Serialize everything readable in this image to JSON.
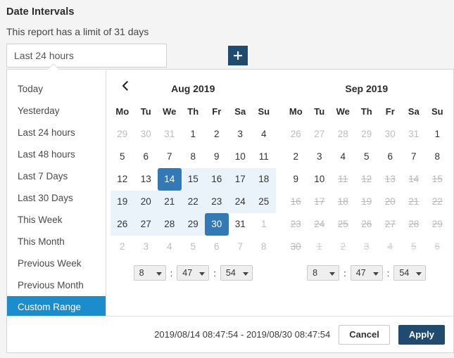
{
  "header": {
    "title": "Date Intervals",
    "limit_note": "This report has a limit of 31 days"
  },
  "input": {
    "value": "Last 24 hours",
    "placeholder": "Last 24 hours"
  },
  "add_button": {
    "icon": "plus-icon",
    "label": "+"
  },
  "colors": {
    "accent_navy": "#214b6e",
    "active_blue": "#1b8dcd",
    "selected_day": "#3279b5",
    "range_highlight": "#eaf3f9"
  },
  "ranges": {
    "items": [
      {
        "label": "Today",
        "active": false
      },
      {
        "label": "Yesterday",
        "active": false
      },
      {
        "label": "Last 24 hours",
        "active": false
      },
      {
        "label": "Last 48 hours",
        "active": false
      },
      {
        "label": "Last 7 Days",
        "active": false
      },
      {
        "label": "Last 30 Days",
        "active": false
      },
      {
        "label": "This Week",
        "active": false
      },
      {
        "label": "This Month",
        "active": false
      },
      {
        "label": "Previous Week",
        "active": false
      },
      {
        "label": "Previous Month",
        "active": false
      },
      {
        "label": "Custom Range",
        "active": true
      }
    ]
  },
  "calendar_left": {
    "title": "Aug 2019",
    "prev_icon": "chevron-left-icon",
    "weekdays": [
      "Mo",
      "Tu",
      "We",
      "Th",
      "Fr",
      "Sa",
      "Su"
    ],
    "weeks": [
      [
        {
          "d": "29",
          "off": true
        },
        {
          "d": "30",
          "off": true
        },
        {
          "d": "31",
          "off": true
        },
        {
          "d": "1"
        },
        {
          "d": "2"
        },
        {
          "d": "3"
        },
        {
          "d": "4"
        }
      ],
      [
        {
          "d": "5"
        },
        {
          "d": "6"
        },
        {
          "d": "7"
        },
        {
          "d": "8"
        },
        {
          "d": "9"
        },
        {
          "d": "10"
        },
        {
          "d": "11"
        }
      ],
      [
        {
          "d": "12"
        },
        {
          "d": "13"
        },
        {
          "d": "14",
          "sel": true,
          "range": true
        },
        {
          "d": "15",
          "range": true
        },
        {
          "d": "16",
          "range": true
        },
        {
          "d": "17",
          "range": true
        },
        {
          "d": "18",
          "range": true
        }
      ],
      [
        {
          "d": "19",
          "range": true
        },
        {
          "d": "20",
          "range": true
        },
        {
          "d": "21",
          "range": true
        },
        {
          "d": "22",
          "range": true
        },
        {
          "d": "23",
          "range": true
        },
        {
          "d": "24",
          "range": true
        },
        {
          "d": "25",
          "range": true
        }
      ],
      [
        {
          "d": "26",
          "range": true
        },
        {
          "d": "27",
          "range": true
        },
        {
          "d": "28",
          "range": true
        },
        {
          "d": "29",
          "range": true
        },
        {
          "d": "30",
          "sel": true,
          "range": true
        },
        {
          "d": "31"
        },
        {
          "d": "1",
          "off": true
        }
      ],
      [
        {
          "d": "2",
          "off": true
        },
        {
          "d": "3",
          "off": true
        },
        {
          "d": "4",
          "off": true
        },
        {
          "d": "5",
          "off": true
        },
        {
          "d": "6",
          "off": true
        },
        {
          "d": "7",
          "off": true
        },
        {
          "d": "8",
          "off": true
        }
      ]
    ],
    "time": {
      "hour": "8",
      "minute": "47",
      "second": "54"
    }
  },
  "calendar_right": {
    "title": "Sep 2019",
    "weekdays": [
      "Mo",
      "Tu",
      "We",
      "Th",
      "Fr",
      "Sa",
      "Su"
    ],
    "weeks": [
      [
        {
          "d": "26",
          "off": true
        },
        {
          "d": "27",
          "off": true
        },
        {
          "d": "28",
          "off": true
        },
        {
          "d": "29",
          "off": true
        },
        {
          "d": "30",
          "off": true
        },
        {
          "d": "31",
          "off": true
        },
        {
          "d": "1"
        }
      ],
      [
        {
          "d": "2"
        },
        {
          "d": "3"
        },
        {
          "d": "4"
        },
        {
          "d": "5"
        },
        {
          "d": "6"
        },
        {
          "d": "7"
        },
        {
          "d": "8"
        }
      ],
      [
        {
          "d": "9"
        },
        {
          "d": "10"
        },
        {
          "d": "11",
          "disabled": true
        },
        {
          "d": "12",
          "disabled": true
        },
        {
          "d": "13",
          "disabled": true
        },
        {
          "d": "14",
          "disabled": true
        },
        {
          "d": "15",
          "disabled": true
        }
      ],
      [
        {
          "d": "16",
          "disabled": true
        },
        {
          "d": "17",
          "disabled": true
        },
        {
          "d": "18",
          "disabled": true
        },
        {
          "d": "19",
          "disabled": true
        },
        {
          "d": "20",
          "disabled": true
        },
        {
          "d": "21",
          "disabled": true
        },
        {
          "d": "22",
          "disabled": true
        }
      ],
      [
        {
          "d": "23",
          "disabled": true
        },
        {
          "d": "24",
          "disabled": true
        },
        {
          "d": "25",
          "disabled": true
        },
        {
          "d": "26",
          "disabled": true
        },
        {
          "d": "27",
          "disabled": true
        },
        {
          "d": "28",
          "disabled": true
        },
        {
          "d": "29",
          "disabled": true
        }
      ],
      [
        {
          "d": "30",
          "disabled": true
        },
        {
          "d": "1",
          "off": true,
          "disabled": true
        },
        {
          "d": "2",
          "off": true,
          "disabled": true
        },
        {
          "d": "3",
          "off": true,
          "disabled": true
        },
        {
          "d": "4",
          "off": true,
          "disabled": true
        },
        {
          "d": "5",
          "off": true,
          "disabled": true
        },
        {
          "d": "6",
          "off": true,
          "disabled": true
        }
      ]
    ],
    "time": {
      "hour": "8",
      "minute": "47",
      "second": "54"
    }
  },
  "footer": {
    "range_label": "2019/08/14 08:47:54 - 2019/08/30 08:47:54",
    "cancel_label": "Cancel",
    "apply_label": "Apply"
  }
}
